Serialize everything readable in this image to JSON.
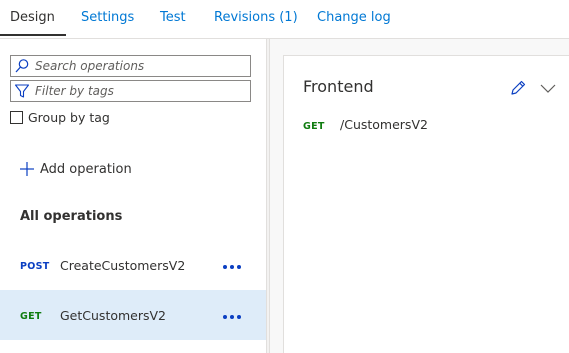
{
  "tabs": [
    {
      "label": "Design",
      "active": true
    },
    {
      "label": "Settings",
      "active": false
    },
    {
      "label": "Test",
      "active": false
    },
    {
      "label": "Revisions (1)",
      "active": false
    },
    {
      "label": "Change log",
      "active": false
    }
  ],
  "search": {
    "placeholder": "Search operations",
    "icon": "search-icon"
  },
  "filter": {
    "placeholder": "Filter by tags",
    "icon": "filter-icon"
  },
  "group_by_tag": {
    "label": "Group by tag",
    "checked": false
  },
  "add_operation": {
    "label": "Add operation",
    "icon": "plus-icon"
  },
  "all_operations_heading": "All operations",
  "operations": [
    {
      "method": "POST",
      "name": "CreateCustomersV2",
      "selected": false
    },
    {
      "method": "GET",
      "name": "GetCustomersV2",
      "selected": true
    }
  ],
  "frontend": {
    "title": "Frontend",
    "method": "GET",
    "path": "/CustomersV2",
    "edit_icon": "pencil-icon",
    "expand_icon": "chevron-down-icon"
  },
  "colors": {
    "accent": "#0078d4",
    "post_method": "#0b3fc2",
    "get_method": "#107c10",
    "selected_row": "#deecf9"
  }
}
